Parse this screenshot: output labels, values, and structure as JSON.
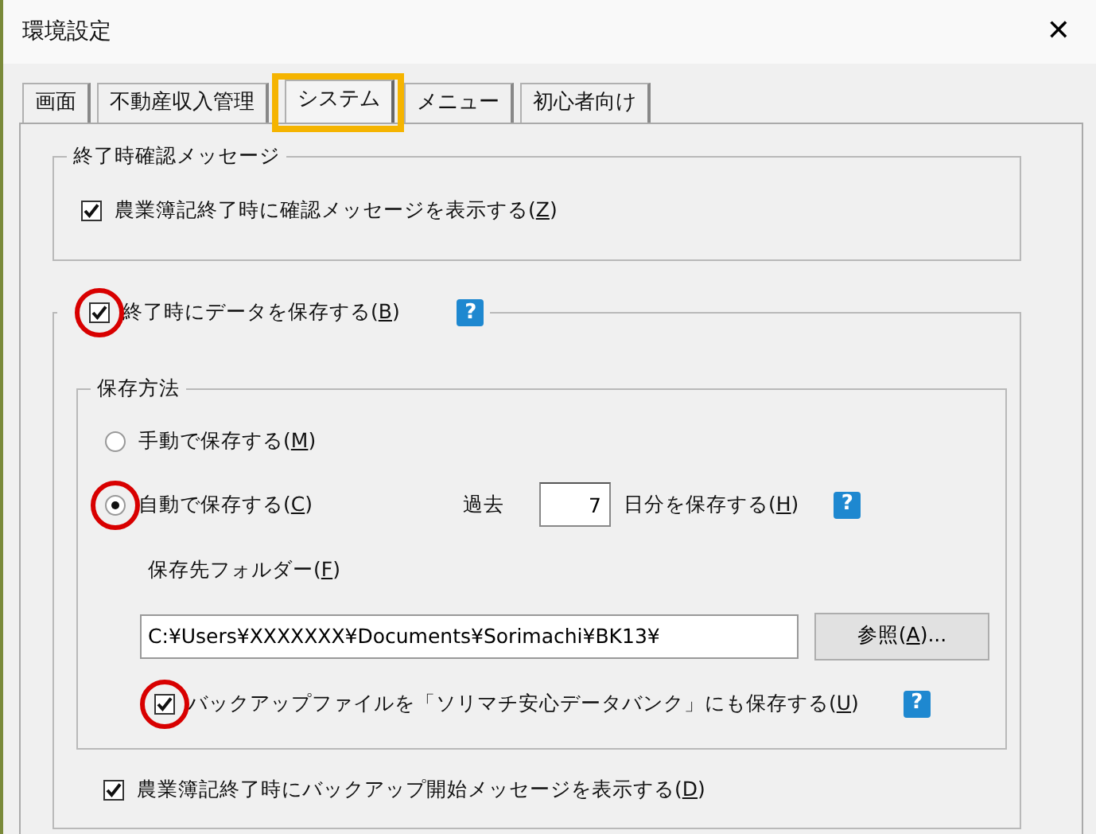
{
  "window": {
    "title": "環境設定",
    "close": "✕"
  },
  "tabs": [
    {
      "label": "画面",
      "selected": false,
      "highlighted": false
    },
    {
      "label": "不動産収入管理",
      "selected": false,
      "highlighted": false
    },
    {
      "label": "システム",
      "selected": true,
      "highlighted": true
    },
    {
      "label": "メニュー",
      "selected": false,
      "highlighted": false
    },
    {
      "label": "初心者向け",
      "selected": false,
      "highlighted": false
    }
  ],
  "exit_confirm": {
    "title": "終了時確認メッセージ",
    "checkbox": {
      "label": "農業簿記終了時に確認メッセージを表示する(Z)",
      "checked": true,
      "circled": false
    }
  },
  "save_on_exit": {
    "checkbox": {
      "label": "終了時にデータを保存する(B)",
      "checked": true,
      "circled": true
    },
    "help": "?",
    "method": {
      "title": "保存方法",
      "options": [
        {
          "label": "手動で保存する(M)",
          "selected": false,
          "circled": false
        },
        {
          "label": "自動で保存する(C)",
          "selected": true,
          "circled": true
        }
      ],
      "days": {
        "prefix": "過去",
        "value": "7",
        "suffix": "日分を保存する(H)",
        "help": "?"
      },
      "folder_label": "保存先フォルダー(F)",
      "folder": "C:¥Users¥XXXXXXX¥Documents¥Sorimachi¥BK13¥",
      "browse": "参照(A)...",
      "bank": {
        "label": "バックアップファイルを「ソリマチ安心データバンク」にも保存する(U)",
        "checked": true,
        "circled": true
      },
      "bank_help": "?"
    },
    "backup_message": {
      "label": "農業簿記終了時にバックアップ開始メッセージを表示する(D)",
      "checked": true,
      "circled": false
    }
  }
}
